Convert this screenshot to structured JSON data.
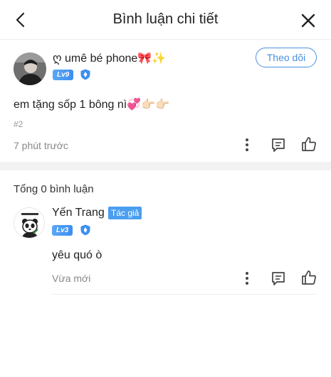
{
  "header": {
    "title": "Bình luận chi tiết",
    "back_icon": "chevron-left-icon",
    "close_icon": "close-icon"
  },
  "post": {
    "username": "ღ umê bé phone🎀✨",
    "level": "Lv9",
    "follow_label": "Theo dõi",
    "content": "em tặng sốp 1 bông nì💞👉🏻👉🏻",
    "floor": "#2",
    "time": "7 phút trước"
  },
  "comments_summary": {
    "total_label": "Tổng 0 bình luận"
  },
  "comment": {
    "username": "Yến Trang",
    "author_tag": "Tác giả",
    "level": "Lv3",
    "content": "yêu quó ò",
    "time": "Vừa mới"
  },
  "colors": {
    "accent": "#4a90e2",
    "level_badge": "#3d8ef0",
    "author_tag": "#4a9ef0",
    "muted_text": "#888888",
    "divider": "#f2f2f2"
  }
}
